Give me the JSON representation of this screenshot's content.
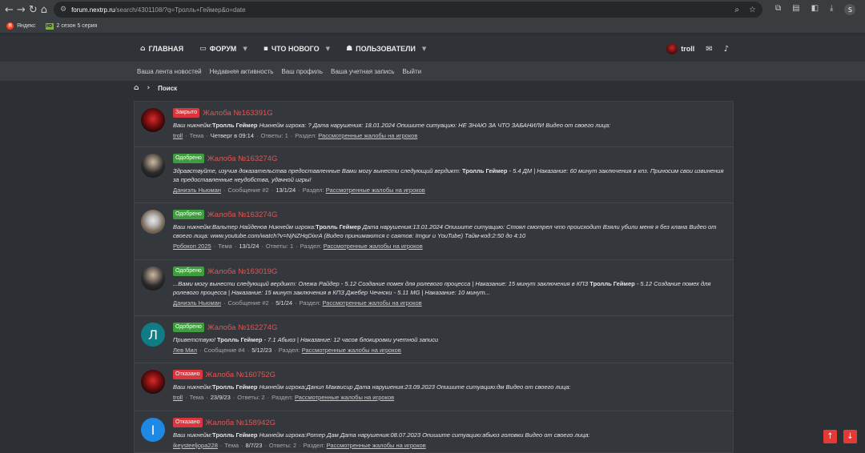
{
  "browser": {
    "url_host": "forum.nextrp.ru",
    "url_path": "/search/4301108/?q=Тролль+Геймер&o=date",
    "bookmarks": [
      {
        "label": "Яндекс"
      },
      {
        "label": "2 сезон 5 серия"
      }
    ]
  },
  "nav": {
    "items": [
      {
        "label": "ГЛАВНАЯ"
      },
      {
        "label": "ФОРУМ"
      },
      {
        "label": "ЧТО НОВОГО"
      },
      {
        "label": "ПОЛЬЗОВАТЕЛИ"
      }
    ],
    "username": "troll"
  },
  "subnav": {
    "items": [
      "Ваша лента новостей",
      "Недавняя активность",
      "Ваш профиль",
      "Ваша учетная запись",
      "Выйти"
    ]
  },
  "breadcrumb": {
    "current": "Поиск"
  },
  "results": [
    {
      "badge": "Закрыто",
      "badge_color": "#d9363e",
      "title": "Жалоба №163391G",
      "snippet_pre": "Ваш никнейм:",
      "snippet_bold": "Тролль Геймер",
      "snippet_post": " Никнейм игрока: ? Дата нарушения: 18.01.2024 Опишите ситуацию: НЕ ЗНАЮ ЗА ЧТО ЗАБАНИЛИ Видео от своего лица:",
      "author": "troll",
      "kind": "Тема",
      "date": "Четверг в 09:14",
      "extra": "Ответы: 1",
      "section_label": "Раздел:",
      "section": "Рассмотренные жалобы на игроков"
    },
    {
      "badge": "Одобрено",
      "badge_color": "#3f9d3f",
      "title": "Жалоба №163274G",
      "snippet_pre": "Здравствуйте, изучив доказательства предоставленные Вами могу вынести следующий вердикт: ",
      "snippet_bold": "Тролль Геймер",
      "snippet_post": " - 5.4 ДМ | Наказание: 60 минут заключения в кпз. Приносим свои извинения за предоставленные неудобства, удачной игры!",
      "author": "Даниэль Ньюман",
      "kind": "Сообщение #2",
      "date": "13/1/24",
      "extra": "",
      "section_label": "Раздел:",
      "section": "Рассмотренные жалобы на игроков"
    },
    {
      "badge": "Одобрено",
      "badge_color": "#3f9d3f",
      "title": "Жалоба №163274G",
      "snippet_pre": "Ваш никнейм:Вальтер Найденов Никнейм игрока:",
      "snippet_bold": "Тролль Геймер",
      "snippet_post": " Дата нарушения:13.01.2024 Опишите ситуацию: Стоял смотрел что происходит Взяли убили меня я без клана Видео от своего лица: www.youtube.com/watch?v=NjNZHqDixrA (Видео принимаются с саятов: Imgur и YouTube) Тайм-код:2:50 до 4:10",
      "author": "Робокоп 2025",
      "kind": "Тема",
      "date": "13/1/24",
      "extra": "Ответы: 1",
      "section_label": "Раздел:",
      "section": "Рассмотренные жалобы на игроков"
    },
    {
      "badge": "Одобрено",
      "badge_color": "#3f9d3f",
      "title": "Жалоба №163019G",
      "snippet_pre": "...Вами могу вынести следующий вердикт: Олежа Райдер - 5.12 Создание помех для ролевого процесса | Наказание: 15 минут заключения в КПЗ ",
      "snippet_bold": "Тролль Геймер",
      "snippet_post": " - 5.12 Создание помех для ролевого процесса | Наказание: 15 минут заключения в КПЗ Джебер Чечнски - 5.11 MG | Наказание: 10 минут...",
      "author": "Даниэль Ньюман",
      "kind": "Сообщение #2",
      "date": "5/1/24",
      "extra": "",
      "section_label": "Раздел:",
      "section": "Рассмотренные жалобы на игроков"
    },
    {
      "badge": "Одобрено",
      "badge_color": "#3f9d3f",
      "title": "Жалоба №162274G",
      "snippet_pre": "Приветствую! ",
      "snippet_bold": "Тролль Геймер",
      "snippet_post": " - 7.1 Абьюз | Наказание: 12 часов блокировки учетной записи",
      "author": "Лев Мил",
      "kind": "Сообщение #4",
      "date": "5/12/23",
      "extra": "",
      "section_label": "Раздел:",
      "section": "Рассмотренные жалобы на игроков",
      "avatar_letter": "Л"
    },
    {
      "badge": "Отказано",
      "badge_color": "#d9363e",
      "title": "Жалоба №160752G",
      "snippet_pre": "Ваш никнейм:",
      "snippet_bold": "Тролль Геймер",
      "snippet_post": " Никнейм игрока:Данил Маквисир Дата нарушения:23.09.2023 Опишите ситуацию:дм Видео от своего лица:",
      "author": "troll",
      "kind": "Тема",
      "date": "23/9/23",
      "extra": "Ответы: 2",
      "section_label": "Раздел:",
      "section": "Рассмотренные жалобы на игроков"
    },
    {
      "badge": "Отказано",
      "badge_color": "#d9363e",
      "title": "Жалоба №158942G",
      "snippet_pre": "Ваш никнейм:",
      "snippet_bold": "Тролль Геймер",
      "snippet_post": " Никнейм игрока:Ротер Дам Дата нарушения:08.07.2023 Опишите ситуацию:абьюз головки Видео от своего лица:",
      "author": "ikeysteeljopa228",
      "kind": "Тема",
      "date": "8/7/23",
      "extra": "Ответы: 2",
      "section_label": "Раздел:",
      "section": "Рассмотренные жалобы на игроков",
      "avatar_letter": "I"
    }
  ],
  "colors": {
    "accent_red": "#e05555",
    "badge_red": "#d9363e",
    "badge_green": "#3f9d3f",
    "scroll_btn": "#e53935"
  }
}
